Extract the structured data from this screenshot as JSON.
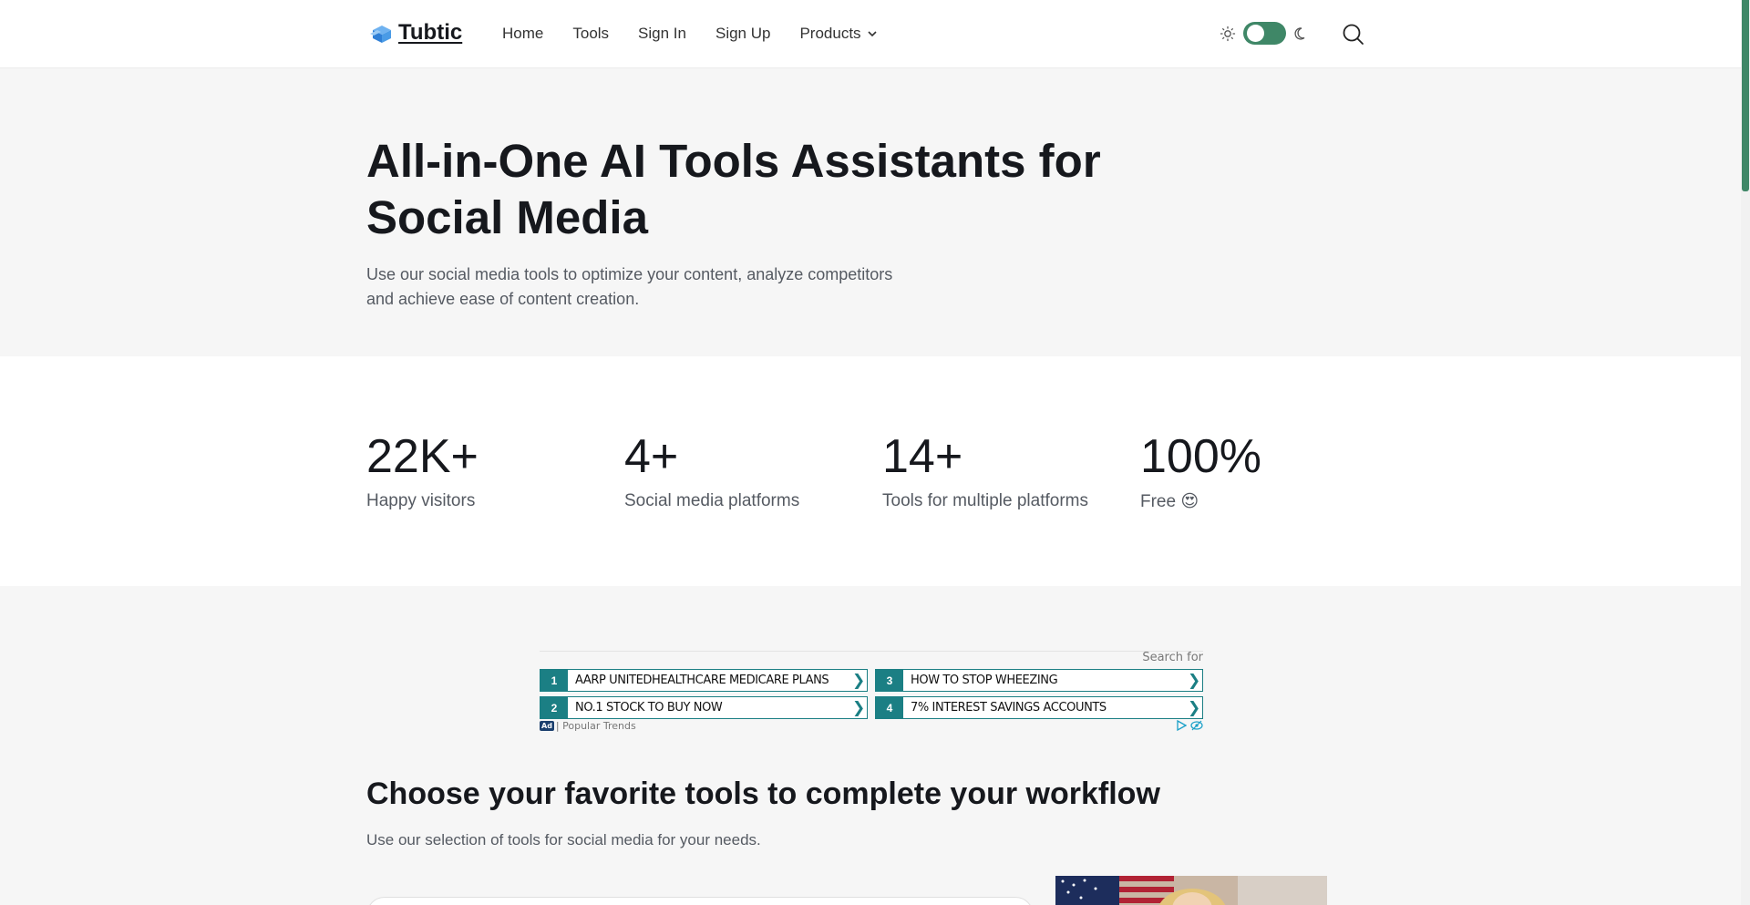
{
  "header": {
    "logo_text": "Tubtic",
    "nav": [
      {
        "label": "Home"
      },
      {
        "label": "Tools"
      },
      {
        "label": "Sign In"
      },
      {
        "label": "Sign Up"
      },
      {
        "label": "Products"
      }
    ],
    "theme_toggle_on": true
  },
  "hero": {
    "title_line1": "All-in-One AI Tools Assistants for",
    "title_line2": "Social Media",
    "subtitle_line1": "Use our social media tools to optimize your content, analyze competitors",
    "subtitle_line2": "and achieve ease of content creation."
  },
  "stats": [
    {
      "value": "22K+",
      "label": "Happy visitors"
    },
    {
      "value": "4+",
      "label": "Social media platforms"
    },
    {
      "value": "14+",
      "label": "Tools for multiple platforms"
    },
    {
      "value": "100%",
      "label": "Free 😍"
    }
  ],
  "ad": {
    "search_for": "Search for",
    "items": [
      {
        "num": "1",
        "text": "AARP UNITEDHEALTHCARE MEDICARE PLANS"
      },
      {
        "num": "2",
        "text": "NO.1 STOCK TO BUY NOW"
      },
      {
        "num": "3",
        "text": "HOW TO STOP WHEEZING"
      },
      {
        "num": "4",
        "text": "7% INTEREST SAVINGS ACCOUNTS"
      }
    ],
    "arrow": "❯",
    "badge": "Ad",
    "footer": "| Popular Trends"
  },
  "workflow": {
    "title": "Choose your favorite tools to complete your workflow",
    "subtitle": "Use our selection of tools for social media for your needs."
  },
  "colors": {
    "accent": "#3f8767",
    "ad_teal": "#1b7f84"
  }
}
